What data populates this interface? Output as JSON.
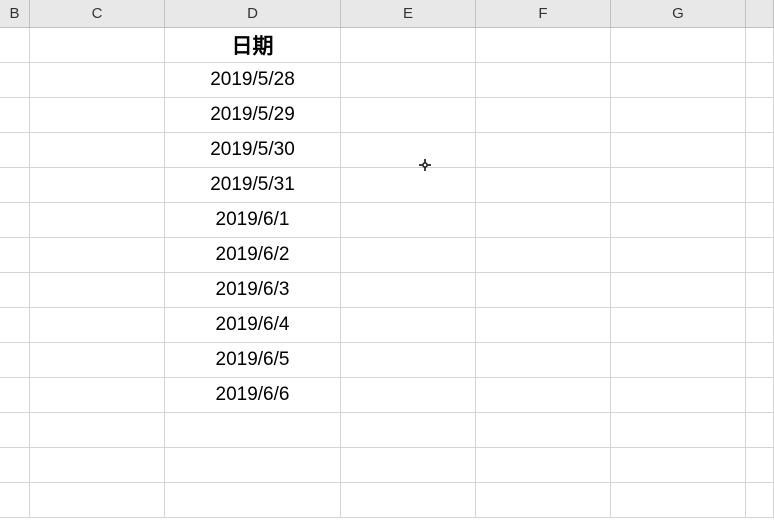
{
  "columnHeaders": {
    "B": "B",
    "C": "C",
    "D": "D",
    "E": "E",
    "F": "F",
    "G": "G"
  },
  "table": {
    "header": "日期",
    "rows": [
      "2019/5/28",
      "2019/5/29",
      "2019/5/30",
      "2019/5/31",
      "2019/6/1",
      "2019/6/2",
      "2019/6/3",
      "2019/6/4",
      "2019/6/5",
      "2019/6/6"
    ]
  }
}
